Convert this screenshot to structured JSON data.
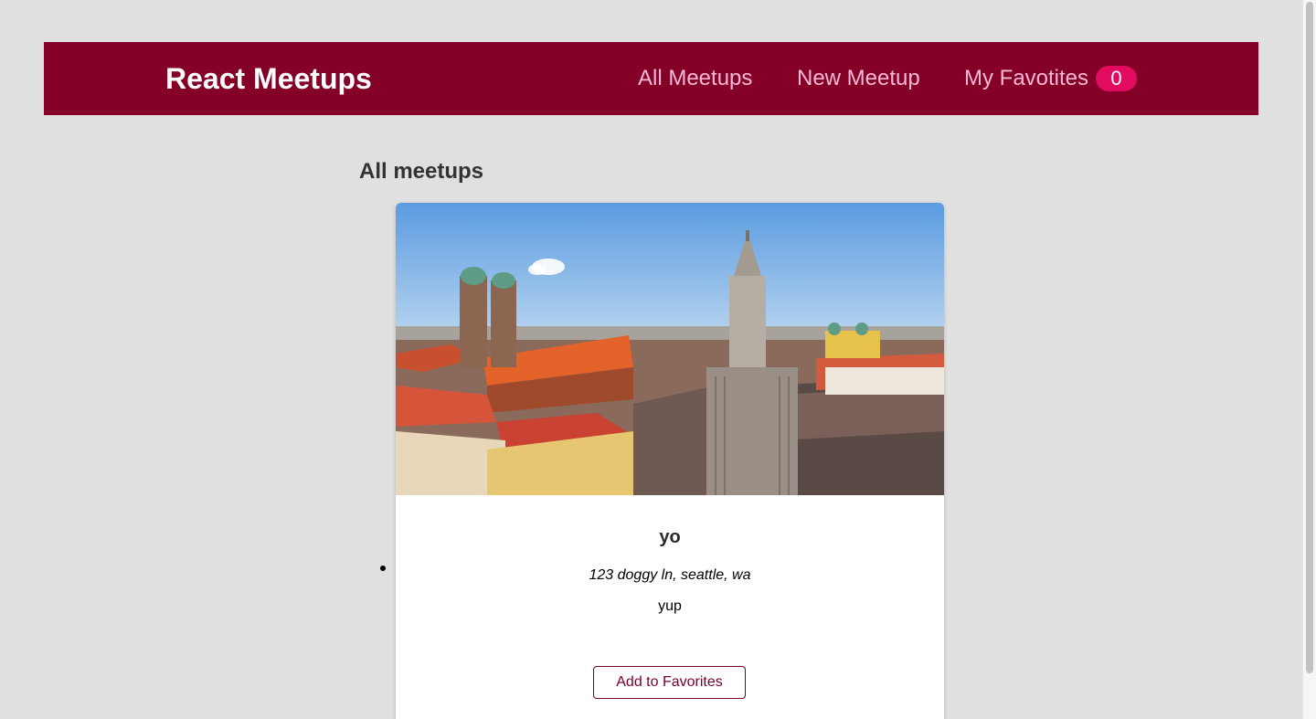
{
  "header": {
    "logo": "React Meetups",
    "nav": {
      "all": "All Meetups",
      "new": "New Meetup",
      "favorites": "My Favotites",
      "favorites_count": "0"
    }
  },
  "main": {
    "title": "All meetups",
    "meetups": [
      {
        "image_alt": "yo",
        "title": "yo",
        "address": "123 doggy ln, seattle, wa",
        "description": "yup",
        "button_label": "Add to Favorites"
      }
    ]
  },
  "colors": {
    "header_bg": "#850027",
    "nav_link": "#fcb8d6",
    "badge_bg": "#e30b5f",
    "button_border": "#77002e",
    "page_bg": "#e0e0e0"
  }
}
